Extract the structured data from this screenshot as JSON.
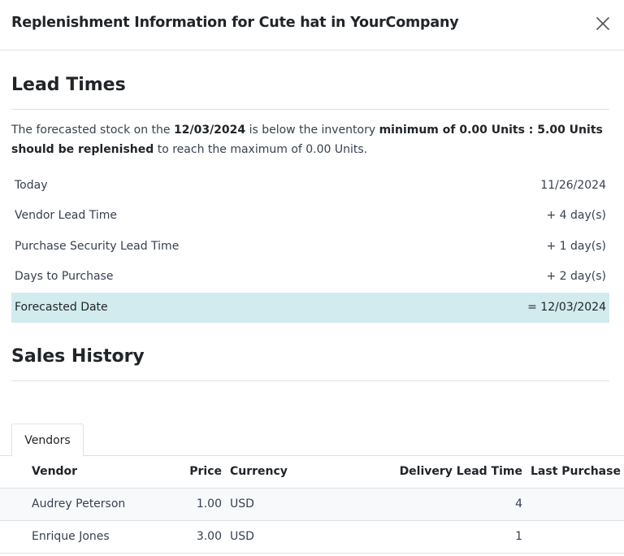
{
  "dialog": {
    "title": "Replenishment Information for Cute hat in YourCompany",
    "close_icon": "close-icon"
  },
  "lead_times": {
    "heading": "Lead Times",
    "message": {
      "part1": "The forecasted stock on the ",
      "date": "12/03/2024",
      "part2": " is below the inventory ",
      "bold_minimum": "minimum of 0.00 Units : 5.00 Units should be replenished",
      "part3": " to reach the maximum of 0.00 Units."
    },
    "rows": [
      {
        "label": "Today",
        "value": "11/26/2024"
      },
      {
        "label": "Vendor Lead Time",
        "value": "+ 4 day(s)"
      },
      {
        "label": "Purchase Security Lead Time",
        "value": "+ 1 day(s)"
      },
      {
        "label": "Days to Purchase",
        "value": "+ 2 day(s)"
      },
      {
        "label": "Forecasted Date",
        "value": "= 12/03/2024"
      }
    ]
  },
  "sales_history": {
    "heading": "Sales History"
  },
  "tabs": [
    {
      "label": "Vendors",
      "active": true
    }
  ],
  "vendors_table": {
    "headers": {
      "vendor": "Vendor",
      "price": "Price",
      "currency": "Currency",
      "delivery": "Delivery Lead Time",
      "last": "Last Purchase"
    },
    "rows": [
      {
        "vendor": "Audrey Peterson",
        "price": "1.00",
        "currency": "USD",
        "delivery": "4",
        "last": ""
      },
      {
        "vendor": "Enrique Jones",
        "price": "3.00",
        "currency": "USD",
        "delivery": "1",
        "last": ""
      }
    ]
  },
  "colors": {
    "highlight_row": "#d2ebef",
    "border": "#dee2e6"
  }
}
